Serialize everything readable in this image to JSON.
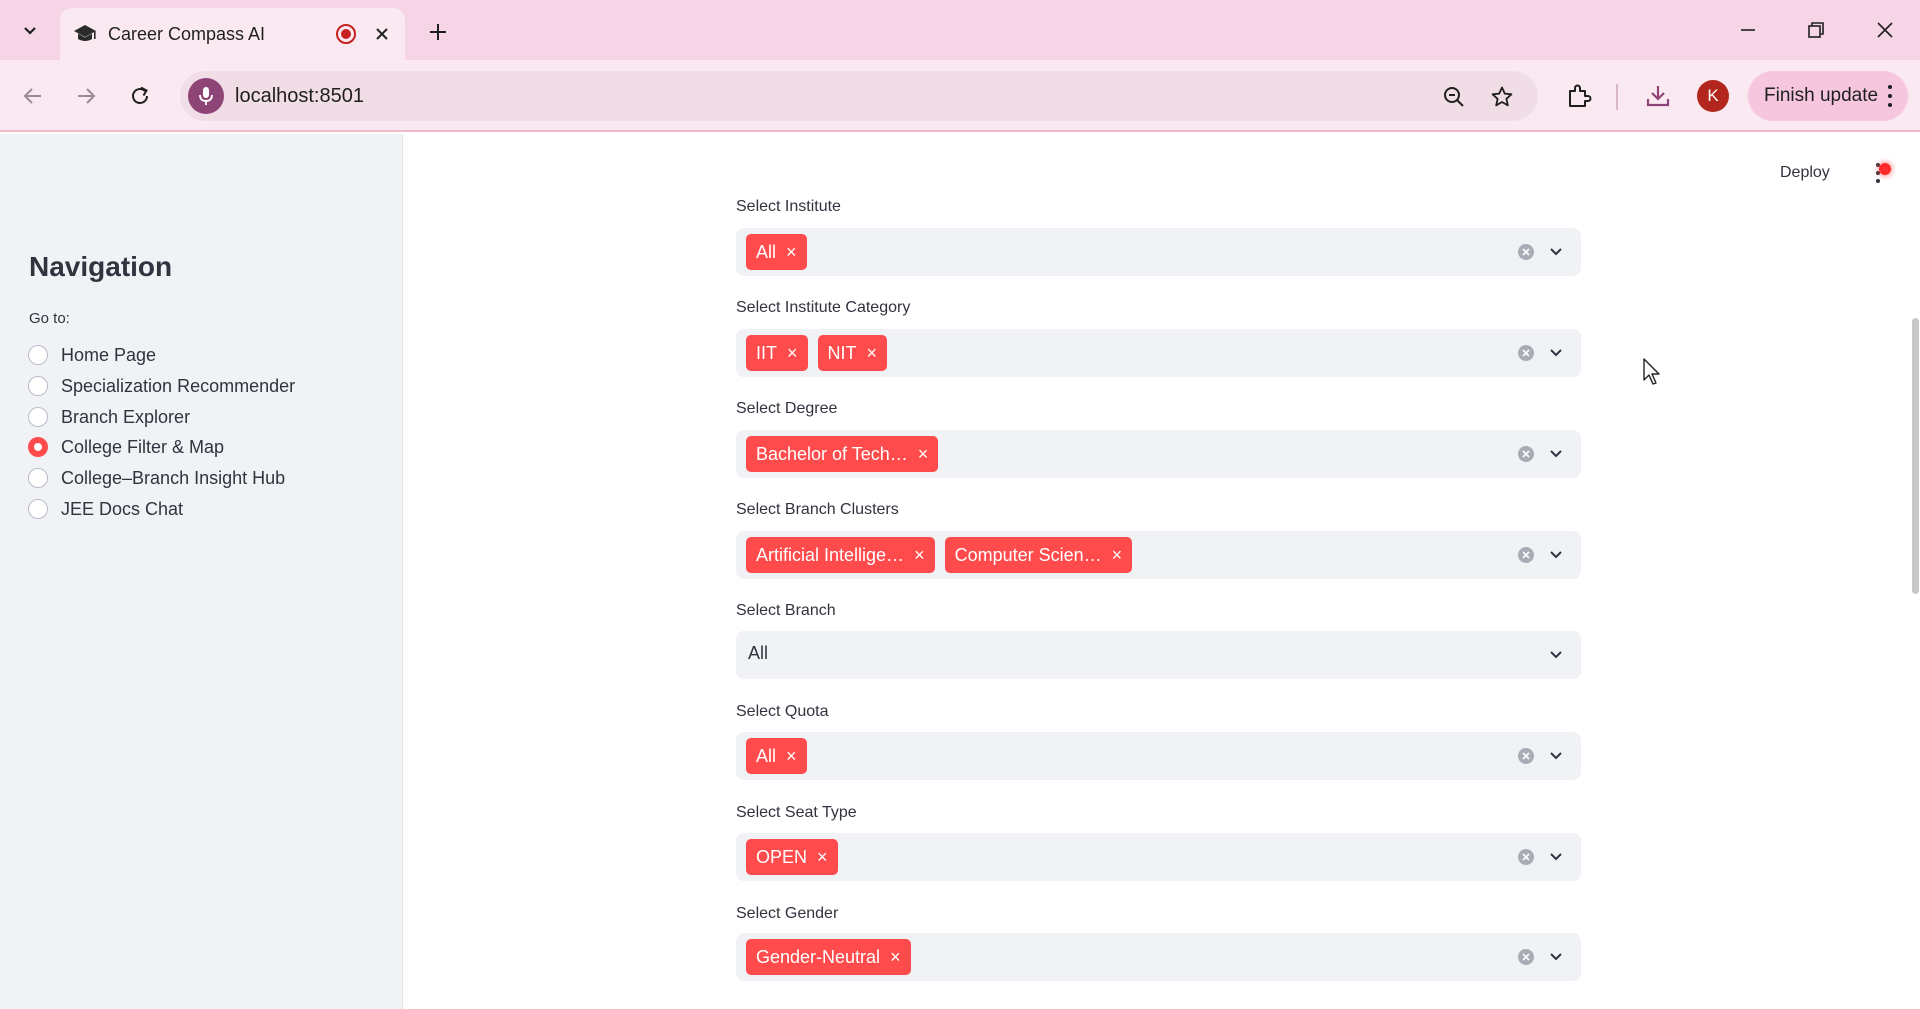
{
  "browser": {
    "tab_title": "Career Compass AI",
    "url": "localhost:8501",
    "profile_initial": "K",
    "finish_update_label": "Finish update"
  },
  "app": {
    "deploy_label": "Deploy",
    "accent_color": "#ff4b4b"
  },
  "sidebar": {
    "title": "Navigation",
    "goto_label": "Go to:",
    "options": [
      {
        "label": "Home Page",
        "selected": false
      },
      {
        "label": "Specialization Recommender",
        "selected": false
      },
      {
        "label": "Branch Explorer",
        "selected": false
      },
      {
        "label": "College Filter & Map",
        "selected": true
      },
      {
        "label": "College–Branch Insight Hub",
        "selected": false
      },
      {
        "label": "JEE Docs Chat",
        "selected": false
      }
    ]
  },
  "filters": {
    "institute": {
      "label": "Select Institute",
      "tags": [
        "All"
      ]
    },
    "institute_category": {
      "label": "Select Institute Category",
      "tags": [
        "IIT",
        "NIT"
      ]
    },
    "degree": {
      "label": "Select Degree",
      "tags": [
        "Bachelor of Tech…"
      ]
    },
    "branch_clusters": {
      "label": "Select Branch Clusters",
      "tags": [
        "Artificial Intellige…",
        "Computer Scien…"
      ]
    },
    "branch": {
      "label": "Select Branch",
      "value": "All"
    },
    "quota": {
      "label": "Select Quota",
      "tags": [
        "All"
      ]
    },
    "seat_type": {
      "label": "Select Seat Type",
      "tags": [
        "OPEN"
      ]
    },
    "gender": {
      "label": "Select Gender",
      "tags": [
        "Gender-Neutral"
      ]
    }
  }
}
